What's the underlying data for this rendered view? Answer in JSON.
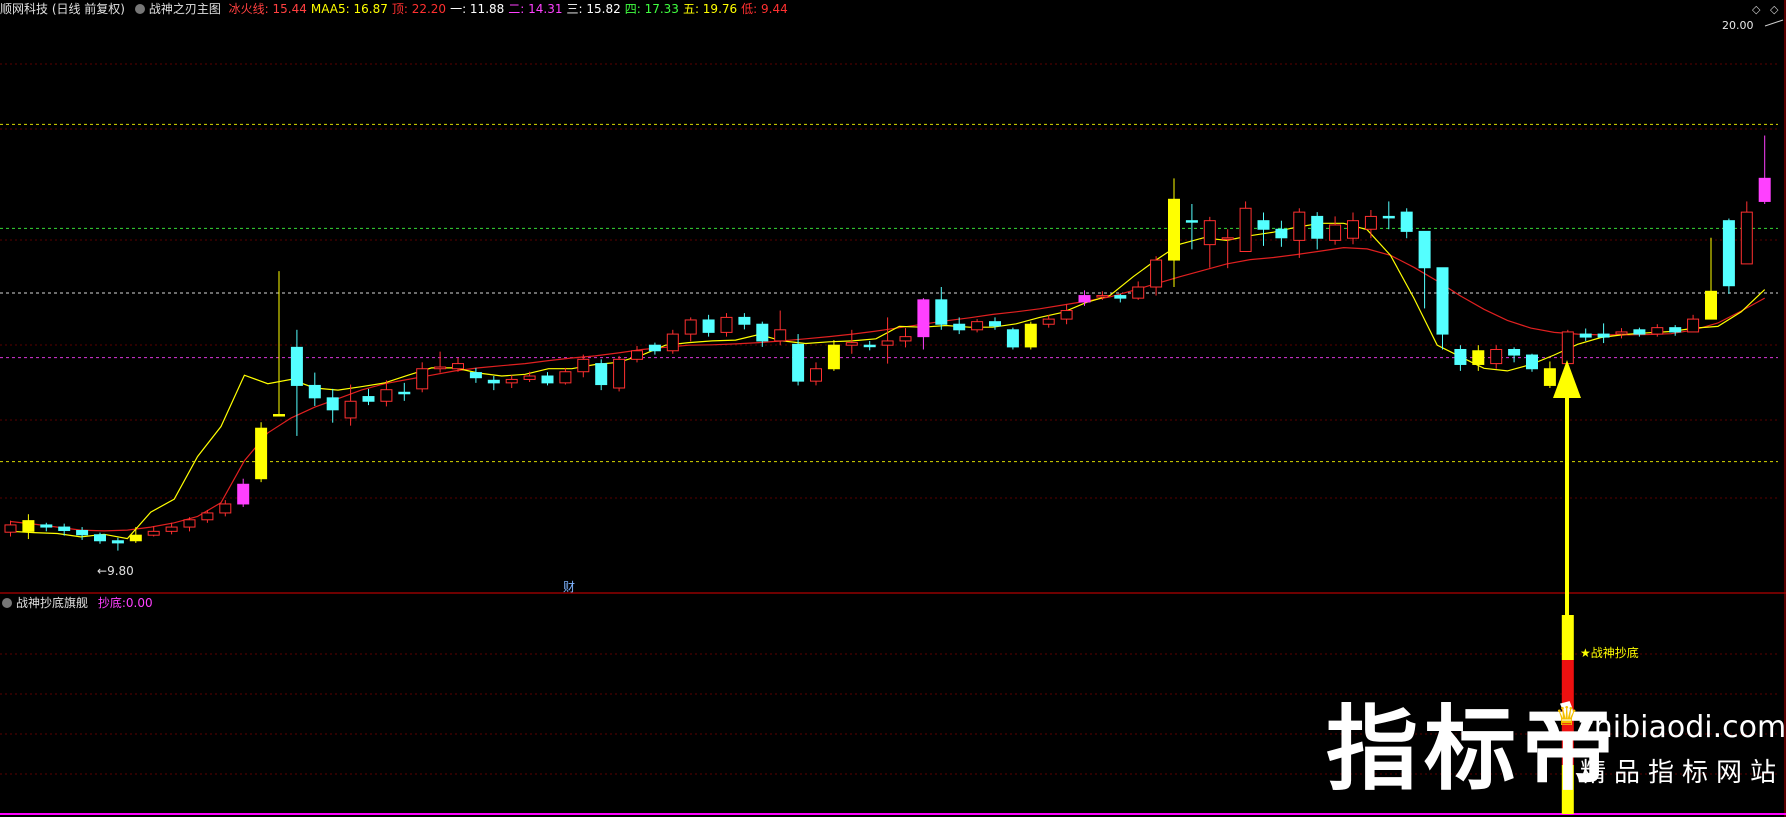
{
  "header": {
    "stock": "顺网科技 (日线 前复权)",
    "indicator": "战神之刃主图",
    "values": [
      {
        "label": "冰火线:",
        "value": "15.44",
        "color": "#ff4040"
      },
      {
        "label": "MAA5:",
        "value": "16.87",
        "color": "#ffff00"
      },
      {
        "label": "顶:",
        "value": "22.20",
        "color": "#ff3030"
      },
      {
        "label": "一:",
        "value": "11.88",
        "color": "#ffffff"
      },
      {
        "label": "二:",
        "value": "14.31",
        "color": "#ff40ff"
      },
      {
        "label": "三:",
        "value": "15.82",
        "color": "#ffffff"
      },
      {
        "label": "四:",
        "value": "17.33",
        "color": "#40ff40"
      },
      {
        "label": "五:",
        "value": "19.76",
        "color": "#ffff00"
      },
      {
        "label": "低:",
        "value": "9.44",
        "color": "#ff3030"
      }
    ]
  },
  "price_labels": {
    "high": "20.00",
    "low": "9.80",
    "finance_marker": "财"
  },
  "sub_header": {
    "indicator": "战神抄底旗舰",
    "label": "抄底:",
    "value": "0.00",
    "value_color": "#ff40ff"
  },
  "signal_text": "★战神抄底",
  "watermark": {
    "brand": "指标帝",
    "url": "zhibiaodi.com",
    "tagline": "精品指标网站"
  },
  "colors": {
    "up": "#ff3030",
    "down": "#54ffff",
    "up_strong": "#ff40ff",
    "yellow": "#ffff00",
    "ma_short": "#ffff00",
    "ma_long": "#e02020",
    "panel_border": "#b00000"
  },
  "icons": [
    "settings-circle-icon",
    "diamond-icon",
    "crown-icon",
    "arrow-up-icon",
    "star-icon"
  ],
  "chart_data": {
    "type": "candlestick",
    "price_range": [
      9.44,
      22.2
    ],
    "reference_levels": [
      {
        "name": "一",
        "value": 11.88,
        "color": "#ffff00"
      },
      {
        "name": "二",
        "value": 14.31,
        "color": "#ff40ff"
      },
      {
        "name": "三",
        "value": 15.82,
        "color": "#ffffff"
      },
      {
        "name": "四",
        "value": 17.33,
        "color": "#40ff40"
      },
      {
        "name": "五",
        "value": 19.76,
        "color": "#ffff00"
      }
    ],
    "candles": [
      [
        10.23,
        10.4,
        10.5,
        10.13,
        "h"
      ],
      [
        10.5,
        10.25,
        10.65,
        10.07,
        "y"
      ],
      [
        10.4,
        10.35,
        10.45,
        10.25,
        "d"
      ],
      [
        10.35,
        10.27,
        10.43,
        10.15,
        "d"
      ],
      [
        10.27,
        10.17,
        10.35,
        10.05,
        "d"
      ],
      [
        10.17,
        10.03,
        10.22,
        9.96,
        "d"
      ],
      [
        10.03,
        9.98,
        10.1,
        9.8,
        "d"
      ],
      [
        10.03,
        10.16,
        10.35,
        9.98,
        "y"
      ],
      [
        10.16,
        10.25,
        10.37,
        10.13,
        "u"
      ],
      [
        10.25,
        10.35,
        10.45,
        10.18,
        "u"
      ],
      [
        10.35,
        10.52,
        10.58,
        10.25,
        "u"
      ],
      [
        10.52,
        10.68,
        10.75,
        10.45,
        "u"
      ],
      [
        10.68,
        10.89,
        10.98,
        10.6,
        "u"
      ],
      [
        10.89,
        11.35,
        11.48,
        10.82,
        "m"
      ],
      [
        11.48,
        12.66,
        12.8,
        11.4,
        "y"
      ],
      [
        12.98,
        12.98,
        16.33,
        12.98,
        "y"
      ],
      [
        14.55,
        13.66,
        14.96,
        12.48,
        "d"
      ],
      [
        13.66,
        13.37,
        13.96,
        13.18,
        "d"
      ],
      [
        13.37,
        13.09,
        13.58,
        12.79,
        "d"
      ],
      [
        12.9,
        13.29,
        13.68,
        12.72,
        "u"
      ],
      [
        13.29,
        13.4,
        13.58,
        13.2,
        "d"
      ],
      [
        13.29,
        13.56,
        13.78,
        13.17,
        "u"
      ],
      [
        13.5,
        13.5,
        13.72,
        13.3,
        "d"
      ],
      [
        13.58,
        14.05,
        14.2,
        13.5,
        "u"
      ],
      [
        14.05,
        14.09,
        14.45,
        13.96,
        "u"
      ],
      [
        14.05,
        14.17,
        14.3,
        13.98,
        "u"
      ],
      [
        13.96,
        13.84,
        14.07,
        13.72,
        "d"
      ],
      [
        13.78,
        13.72,
        13.88,
        13.55,
        "d"
      ],
      [
        13.72,
        13.8,
        13.9,
        13.6,
        "u"
      ],
      [
        13.8,
        13.88,
        13.98,
        13.74,
        "u"
      ],
      [
        13.88,
        13.72,
        13.97,
        13.66,
        "d"
      ],
      [
        13.72,
        13.98,
        14.07,
        13.68,
        "u"
      ],
      [
        13.98,
        14.27,
        14.38,
        13.85,
        "u"
      ],
      [
        14.17,
        13.68,
        14.27,
        13.55,
        "d"
      ],
      [
        13.6,
        14.27,
        14.35,
        13.52,
        "u"
      ],
      [
        14.27,
        14.47,
        14.58,
        14.2,
        "u"
      ],
      [
        14.47,
        14.6,
        14.66,
        14.38,
        "d"
      ],
      [
        14.47,
        14.86,
        14.96,
        14.4,
        "u"
      ],
      [
        14.86,
        15.19,
        15.25,
        14.69,
        "u"
      ],
      [
        15.19,
        14.9,
        15.31,
        14.8,
        "d"
      ],
      [
        14.9,
        15.25,
        15.35,
        14.8,
        "u"
      ],
      [
        15.25,
        15.09,
        15.35,
        14.97,
        "d"
      ],
      [
        15.09,
        14.7,
        15.15,
        14.56,
        "d"
      ],
      [
        14.7,
        14.96,
        15.41,
        14.6,
        "u"
      ],
      [
        14.62,
        13.76,
        14.86,
        13.66,
        "d"
      ],
      [
        13.76,
        14.05,
        14.2,
        13.66,
        "u"
      ],
      [
        14.05,
        14.6,
        14.72,
        14.0,
        "y"
      ],
      [
        14.6,
        14.66,
        14.96,
        14.4,
        "u"
      ],
      [
        14.6,
        14.6,
        14.7,
        14.48,
        "d"
      ],
      [
        14.6,
        14.7,
        15.25,
        14.17,
        "u"
      ],
      [
        14.7,
        14.8,
        15.0,
        14.55,
        "u"
      ],
      [
        14.8,
        15.66,
        15.7,
        14.5,
        "m"
      ],
      [
        15.66,
        15.09,
        15.96,
        14.96,
        "d"
      ],
      [
        15.09,
        14.96,
        15.25,
        14.86,
        "d"
      ],
      [
        14.96,
        15.15,
        15.21,
        14.9,
        "u"
      ],
      [
        15.15,
        15.05,
        15.25,
        14.96,
        "d"
      ],
      [
        14.96,
        14.56,
        15.01,
        14.5,
        "d"
      ],
      [
        14.56,
        15.09,
        15.15,
        14.5,
        "y"
      ],
      [
        15.09,
        15.21,
        15.31,
        15.01,
        "u"
      ],
      [
        15.21,
        15.41,
        15.56,
        15.09,
        "u"
      ],
      [
        15.61,
        15.76,
        15.88,
        15.52,
        "m"
      ],
      [
        15.76,
        15.76,
        15.86,
        15.66,
        "u"
      ],
      [
        15.76,
        15.7,
        15.8,
        15.6,
        "d"
      ],
      [
        15.7,
        15.96,
        16.09,
        15.66,
        "u"
      ],
      [
        15.96,
        16.59,
        16.68,
        15.76,
        "u"
      ],
      [
        16.59,
        18.01,
        18.5,
        15.96,
        "y"
      ],
      [
        17.51,
        17.51,
        17.9,
        16.84,
        "d"
      ],
      [
        16.95,
        17.51,
        17.6,
        16.41,
        "u"
      ],
      [
        17.11,
        17.11,
        17.31,
        16.4,
        "u"
      ],
      [
        16.79,
        17.8,
        17.96,
        16.8,
        "u"
      ],
      [
        17.51,
        17.31,
        17.7,
        16.92,
        "d"
      ],
      [
        17.31,
        17.11,
        17.51,
        16.9,
        "d"
      ],
      [
        17.05,
        17.71,
        17.8,
        16.64,
        "u"
      ],
      [
        17.61,
        17.1,
        17.71,
        16.84,
        "d"
      ],
      [
        17.05,
        17.41,
        17.61,
        16.95,
        "u"
      ],
      [
        17.1,
        17.51,
        17.7,
        16.96,
        "u"
      ],
      [
        17.31,
        17.61,
        17.76,
        17.1,
        "u"
      ],
      [
        17.61,
        17.61,
        17.96,
        17.31,
        "d"
      ],
      [
        17.71,
        17.26,
        17.8,
        17.1,
        "d"
      ],
      [
        17.26,
        16.41,
        16.56,
        15.46,
        "d"
      ],
      [
        16.41,
        14.86,
        15.11,
        14.5,
        "d"
      ],
      [
        14.5,
        14.15,
        14.6,
        14.0,
        "d"
      ],
      [
        14.15,
        14.47,
        14.6,
        14.0,
        "y"
      ],
      [
        14.17,
        14.5,
        14.6,
        14.05,
        "u"
      ],
      [
        14.5,
        14.37,
        14.55,
        14.2,
        "d"
      ],
      [
        14.37,
        14.05,
        14.4,
        13.98,
        "d"
      ],
      [
        14.05,
        13.66,
        14.22,
        13.6,
        "y"
      ],
      [
        14.17,
        14.91,
        14.96,
        14.0,
        "u"
      ],
      [
        14.86,
        14.79,
        14.99,
        14.7,
        "d"
      ],
      [
        14.86,
        14.79,
        15.11,
        14.65,
        "d"
      ],
      [
        14.86,
        14.91,
        15.0,
        14.76,
        "u"
      ],
      [
        14.96,
        14.86,
        15.01,
        14.8,
        "d"
      ],
      [
        14.86,
        15.01,
        15.09,
        14.8,
        "u"
      ],
      [
        15.01,
        14.91,
        15.07,
        14.82,
        "d"
      ],
      [
        14.91,
        15.21,
        15.31,
        14.91,
        "u"
      ],
      [
        15.21,
        15.86,
        17.11,
        15.21,
        "y"
      ],
      [
        17.51,
        15.99,
        17.56,
        15.8,
        "d"
      ],
      [
        16.5,
        17.71,
        17.96,
        16.6,
        "u"
      ],
      [
        17.96,
        18.5,
        19.5,
        17.9,
        "m"
      ]
    ],
    "ma_short": [
      [
        10.25,
        10.22
      ],
      [
        10.2,
        10.12
      ],
      [
        10.18,
        10.08
      ],
      [
        10.7,
        11.0
      ],
      [
        12.0,
        12.7
      ],
      [
        13.9,
        13.7
      ],
      [
        13.8,
        13.6
      ],
      [
        13.55,
        13.63
      ],
      [
        13.72,
        13.9
      ],
      [
        14.07,
        14.07
      ],
      [
        13.95,
        13.88
      ],
      [
        13.92,
        14.05
      ],
      [
        14.05,
        14.15
      ],
      [
        14.2,
        14.37
      ],
      [
        14.6,
        14.66
      ],
      [
        14.7,
        14.72
      ],
      [
        14.85,
        14.7
      ],
      [
        14.64,
        14.68
      ],
      [
        14.7,
        14.75
      ],
      [
        15.04,
        15.02
      ],
      [
        15.06,
        15.02
      ],
      [
        15.02,
        15.1
      ],
      [
        15.25,
        15.37
      ],
      [
        15.6,
        15.76
      ],
      [
        16.2,
        16.6
      ],
      [
        16.96,
        17.11
      ],
      [
        17.05,
        17.16
      ],
      [
        17.24,
        17.36
      ],
      [
        17.45,
        17.45
      ],
      [
        17.3,
        16.7
      ],
      [
        15.7,
        14.6
      ],
      [
        14.33,
        14.06
      ],
      [
        14.0,
        14.15
      ],
      [
        14.37,
        14.62
      ],
      [
        14.78,
        14.85
      ],
      [
        14.89,
        14.92
      ],
      [
        15.0,
        15.04
      ],
      [
        15.38,
        15.9
      ]
    ],
    "ma_long": [
      [
        10.48,
        10.42
      ],
      [
        10.35,
        10.28
      ],
      [
        10.26,
        10.28
      ],
      [
        10.35,
        10.45
      ],
      [
        10.6,
        10.92
      ],
      [
        11.9,
        12.55
      ],
      [
        12.9,
        13.15
      ],
      [
        13.35,
        13.55
      ],
      [
        13.7,
        13.8
      ],
      [
        13.9,
        14.0
      ],
      [
        14.07,
        14.12
      ],
      [
        14.17,
        14.24
      ],
      [
        14.3,
        14.35
      ],
      [
        14.42,
        14.5
      ],
      [
        14.55,
        14.6
      ],
      [
        14.61,
        14.63
      ],
      [
        14.66,
        14.7
      ],
      [
        14.75,
        14.8
      ],
      [
        14.86,
        14.93
      ],
      [
        15.01,
        15.09
      ],
      [
        15.17,
        15.24
      ],
      [
        15.32,
        15.38
      ],
      [
        15.45,
        15.54
      ],
      [
        15.63,
        15.73
      ],
      [
        15.88,
        16.04
      ],
      [
        16.2,
        16.35
      ],
      [
        16.5,
        16.6
      ],
      [
        16.65,
        16.72
      ],
      [
        16.8,
        16.88
      ],
      [
        16.85,
        16.7
      ],
      [
        16.42,
        16.1
      ],
      [
        15.75,
        15.44
      ],
      [
        15.18,
        15.0
      ],
      [
        14.9,
        14.86
      ],
      [
        14.84,
        14.84
      ],
      [
        14.85,
        14.87
      ],
      [
        14.96,
        15.12
      ],
      [
        15.4,
        15.7
      ]
    ],
    "signal_bar": {
      "candle_index": 87,
      "segments": [
        "yellow",
        "red",
        "yellow"
      ]
    },
    "sub_value": 0.0
  }
}
